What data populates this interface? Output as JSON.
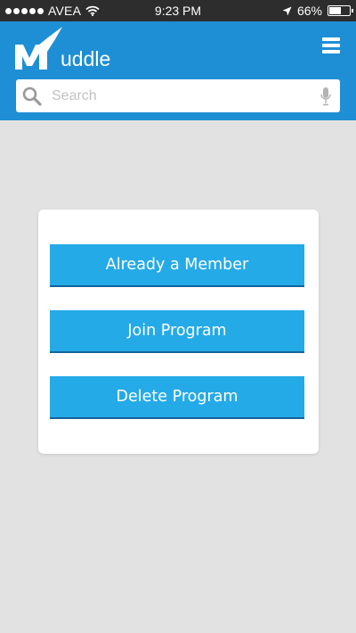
{
  "status_bar": {
    "carrier": "AVEA",
    "time": "9:23 PM",
    "battery_text": "66%",
    "battery_level": 0.66,
    "signal_dots": 5,
    "icons": [
      "signal-dots-icon",
      "wifi-icon",
      "location-arrow-icon",
      "battery-icon"
    ]
  },
  "header": {
    "logo_text": "uddle",
    "logo_letter": "M",
    "menu_icon": "hamburger-menu-icon",
    "background_color": "#1e8fd4"
  },
  "search": {
    "placeholder": "Search",
    "value": "",
    "icons": [
      "search-icon",
      "microphone-icon"
    ]
  },
  "card": {
    "buttons": [
      {
        "label": "Already a Member"
      },
      {
        "label": "Join Program"
      },
      {
        "label": "Delete Program"
      }
    ],
    "button_color": "#25aae8"
  },
  "page": {
    "background_color": "#e2e2e2"
  }
}
